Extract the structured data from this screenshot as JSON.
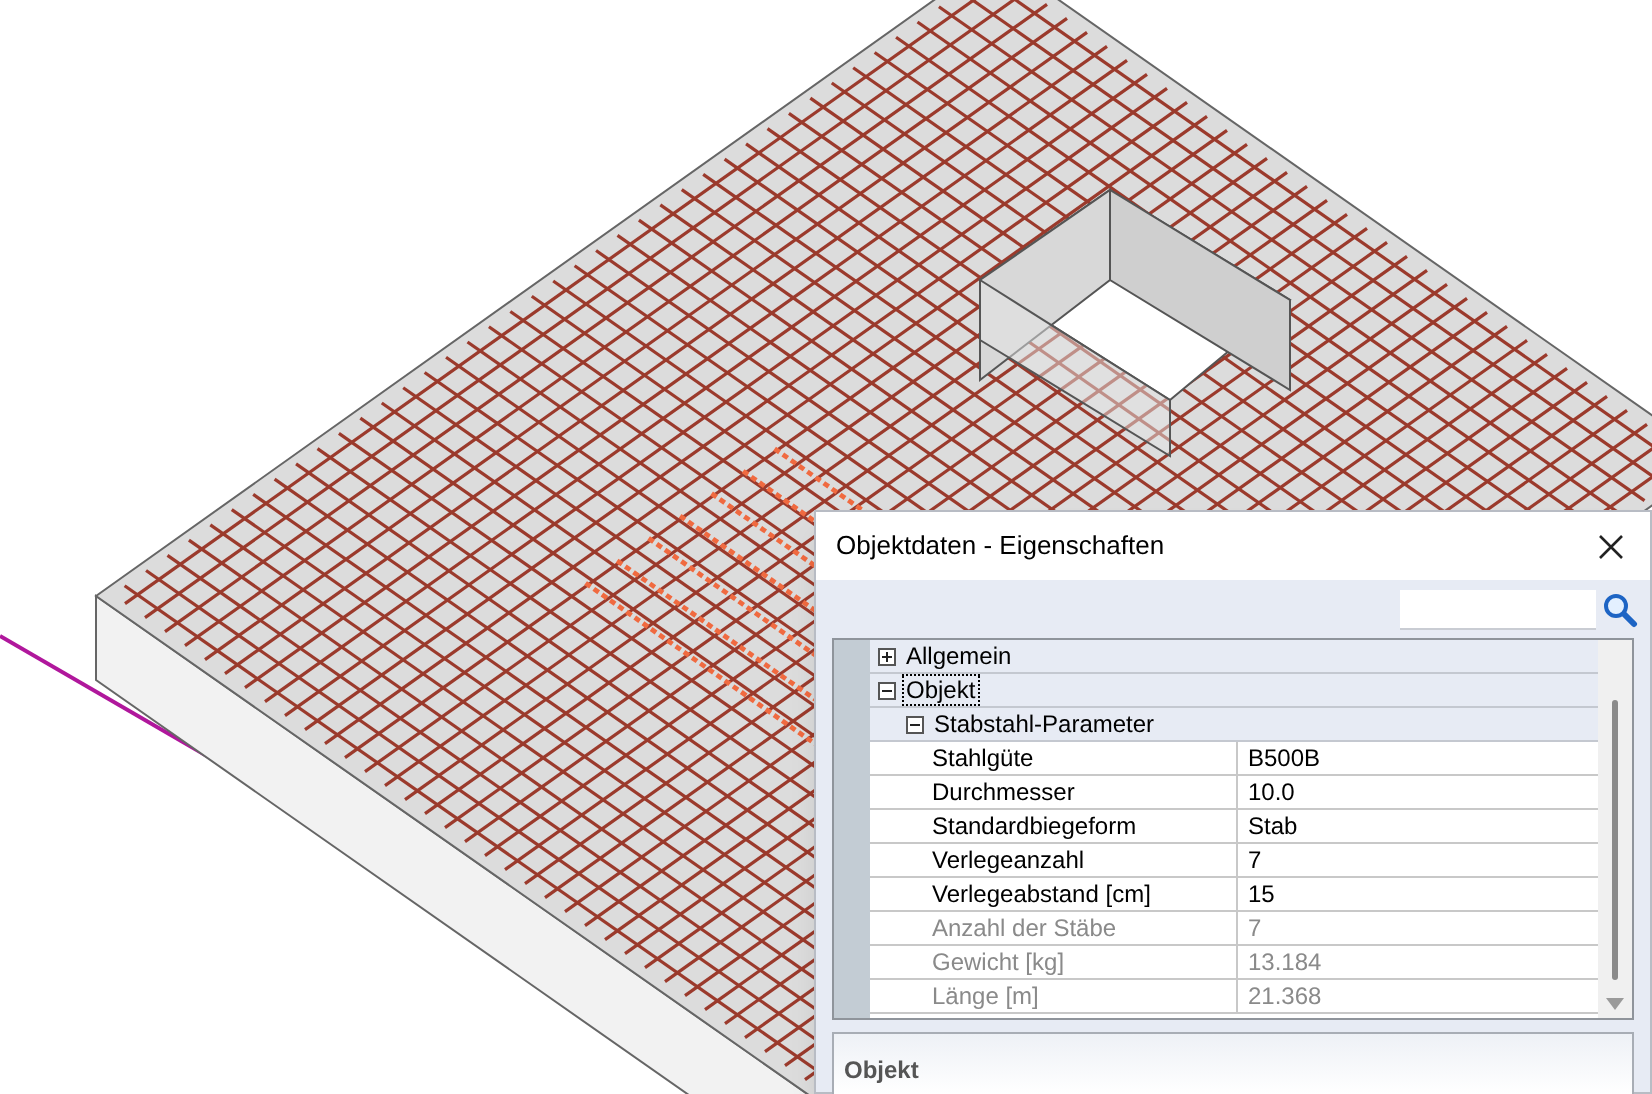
{
  "dialog": {
    "title": "Objektdaten - Eigenschaften",
    "properties": [
      {
        "kind": "group",
        "label": "Allgemein",
        "expanded": false,
        "selected": false
      },
      {
        "kind": "group",
        "label": "Objekt",
        "expanded": true,
        "selected": true,
        "children": [
          {
            "kind": "group",
            "label": "Stabstahl-Parameter",
            "expanded": true,
            "selected": false,
            "children": [
              {
                "kind": "property",
                "label": "Stahlgüte",
                "value": "B500B",
                "disabled": false
              },
              {
                "kind": "property",
                "label": "Durchmesser",
                "value": "10.0",
                "disabled": false
              },
              {
                "kind": "property",
                "label": "Standardbiegeform",
                "value": "Stab",
                "disabled": false
              },
              {
                "kind": "property",
                "label": "Verlegeanzahl",
                "value": "7",
                "disabled": false
              },
              {
                "kind": "property",
                "label": "Verlegeabstand [cm]",
                "value": "15",
                "disabled": false
              },
              {
                "kind": "property",
                "label": "Anzahl der Stäbe",
                "value": "7",
                "disabled": true
              },
              {
                "kind": "property",
                "label": "Gewicht [kg]",
                "value": "13.184",
                "disabled": true
              },
              {
                "kind": "property",
                "label": "Länge [m]",
                "value": "21.368",
                "disabled": true
              }
            ]
          }
        ]
      }
    ],
    "description": {
      "title": "Objekt"
    }
  }
}
